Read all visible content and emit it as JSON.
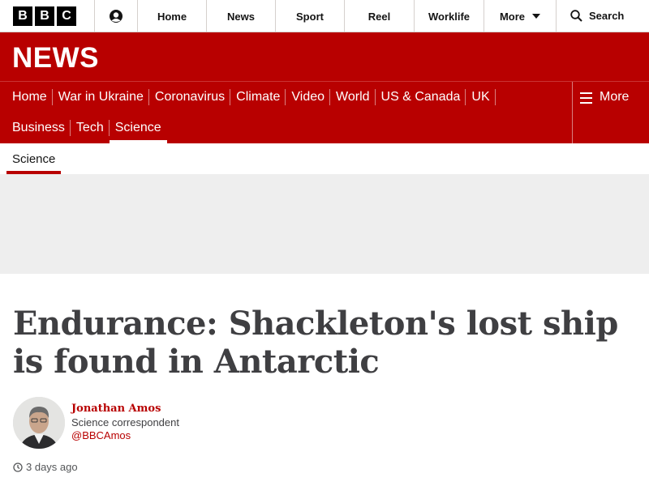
{
  "brand": {
    "letters": [
      "B",
      "B",
      "C"
    ]
  },
  "topnav": {
    "items": [
      {
        "label": "Home"
      },
      {
        "label": "News"
      },
      {
        "label": "Sport"
      },
      {
        "label": "Reel"
      },
      {
        "label": "Worklife"
      }
    ],
    "more_label": "More",
    "search_label": "Search"
  },
  "news_banner": {
    "title": "NEWS"
  },
  "section_nav": {
    "row1": [
      {
        "label": "Home"
      },
      {
        "label": "War in Ukraine"
      },
      {
        "label": "Coronavirus"
      },
      {
        "label": "Climate"
      },
      {
        "label": "Video"
      },
      {
        "label": "World"
      },
      {
        "label": "US & Canada"
      },
      {
        "label": "UK"
      }
    ],
    "row2": [
      {
        "label": "Business"
      },
      {
        "label": "Tech"
      },
      {
        "label": "Science"
      }
    ],
    "active": "Science",
    "more_label": "More"
  },
  "subnav": {
    "label": "Science"
  },
  "article": {
    "headline": "Endurance: Shackleton's lost ship is found in Antarctic",
    "author": {
      "name": "Jonathan Amos",
      "role": "Science correspondent",
      "handle": "@BBCAmos"
    },
    "timestamp": "3 days ago"
  },
  "colors": {
    "brand_red": "#b80000",
    "headline": "#3f3f42",
    "ad_bg": "#eeeeee"
  },
  "icons": [
    "account-icon",
    "chevron-down-icon",
    "search-icon",
    "menu-icon",
    "clock-icon"
  ]
}
